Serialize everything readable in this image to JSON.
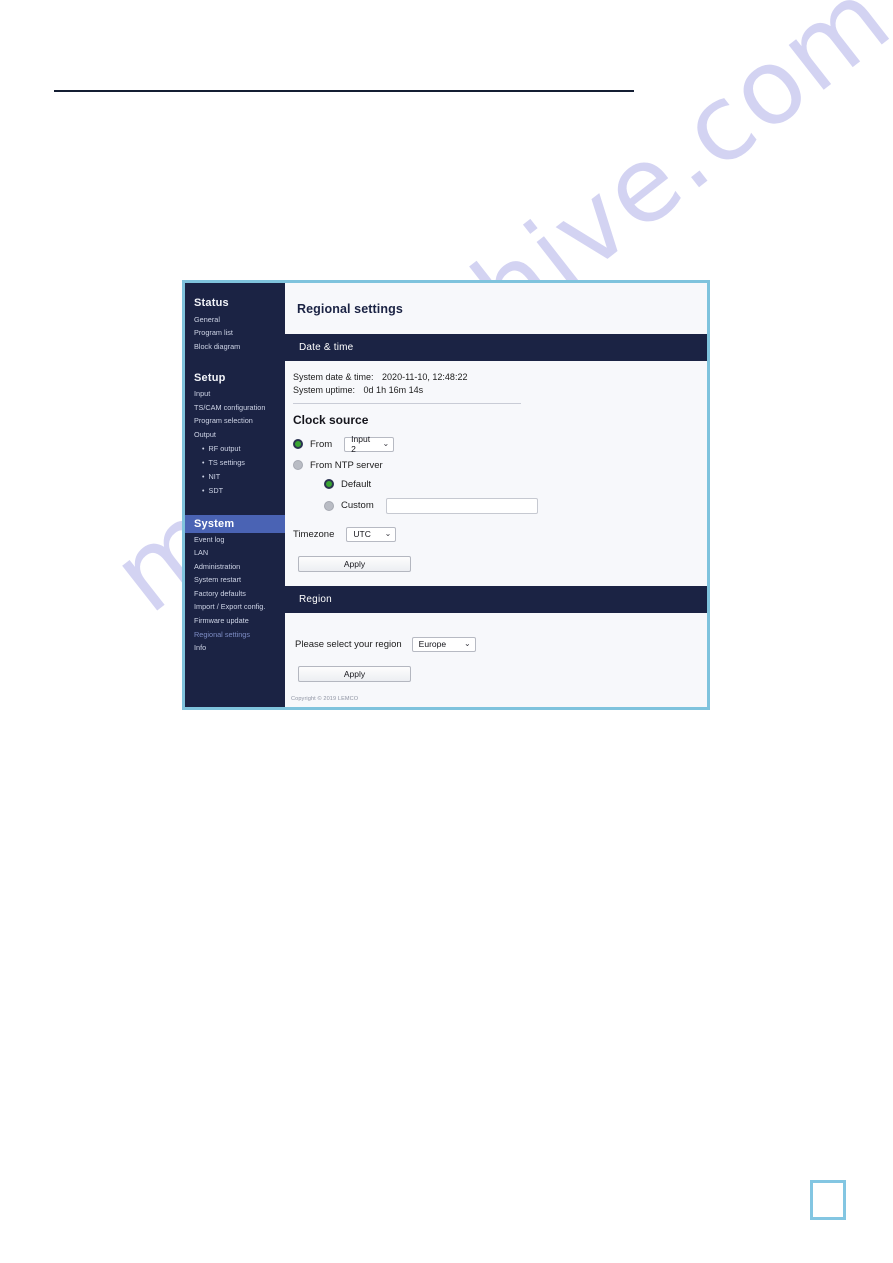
{
  "watermark": {
    "text": "manualshive.com"
  },
  "ui": {
    "sidebar": {
      "groups": [
        {
          "heading": "Status",
          "items": [
            {
              "label": "General",
              "sub": false,
              "active": false
            },
            {
              "label": "Program list",
              "sub": false,
              "active": false
            },
            {
              "label": "Block diagram",
              "sub": false,
              "active": false
            }
          ]
        },
        {
          "heading": "Setup",
          "items": [
            {
              "label": "Input",
              "sub": false,
              "active": false
            },
            {
              "label": "TS/CAM configuration",
              "sub": false,
              "active": false
            },
            {
              "label": "Program selection",
              "sub": false,
              "active": false
            },
            {
              "label": "Output",
              "sub": false,
              "active": false
            },
            {
              "label": "RF output",
              "sub": true,
              "active": false
            },
            {
              "label": "TS settings",
              "sub": true,
              "active": false
            },
            {
              "label": "NIT",
              "sub": true,
              "active": false
            },
            {
              "label": "SDT",
              "sub": true,
              "active": false
            }
          ]
        },
        {
          "heading": "System",
          "heading_active": true,
          "items": [
            {
              "label": "Event log",
              "sub": false,
              "active": false
            },
            {
              "label": "LAN",
              "sub": false,
              "active": false
            },
            {
              "label": "Administration",
              "sub": false,
              "active": false
            },
            {
              "label": "System restart",
              "sub": false,
              "active": false
            },
            {
              "label": "Factory defaults",
              "sub": false,
              "active": false
            },
            {
              "label": "Import / Export config.",
              "sub": false,
              "active": false
            },
            {
              "label": "Firmware update",
              "sub": false,
              "active": false
            },
            {
              "label": "Regional settings",
              "sub": false,
              "active": true
            },
            {
              "label": "Info",
              "sub": false,
              "active": false
            }
          ]
        }
      ]
    },
    "page_title": "Regional settings",
    "datetime_section": {
      "band_label": "Date & time",
      "system_datetime_label": "System date & time:",
      "system_datetime_value": "2020-11-10, 12:48:22",
      "system_uptime_label": "System uptime:",
      "system_uptime_value": "0d 1h 16m 14s",
      "clock_source_title": "Clock source",
      "from_label": "From",
      "from_selected": true,
      "from_select_value": "Input 2",
      "from_ntp_label": "From NTP server",
      "from_ntp_selected": false,
      "ntp_default_label": "Default",
      "ntp_default_selected": true,
      "ntp_custom_label": "Custom",
      "ntp_custom_selected": false,
      "ntp_custom_value": "",
      "ntp_custom_placeholder": "",
      "timezone_label": "Timezone",
      "timezone_value": "UTC",
      "apply_label": "Apply"
    },
    "region_section": {
      "band_label": "Region",
      "region_label": "Please select your region",
      "region_value": "Europe",
      "apply_label": "Apply"
    },
    "copyright": "Copyright © 2019 LEMCO",
    "icons": {
      "caret": "⌄"
    },
    "colors": {
      "sidebar_bg": "#1b2344",
      "band_bg": "#1b2344",
      "active_nav_bg": "#4a63b4",
      "panel_border": "#7fc3dd",
      "radio_on": "#3aa532",
      "watermark": "#ccccf0"
    }
  }
}
